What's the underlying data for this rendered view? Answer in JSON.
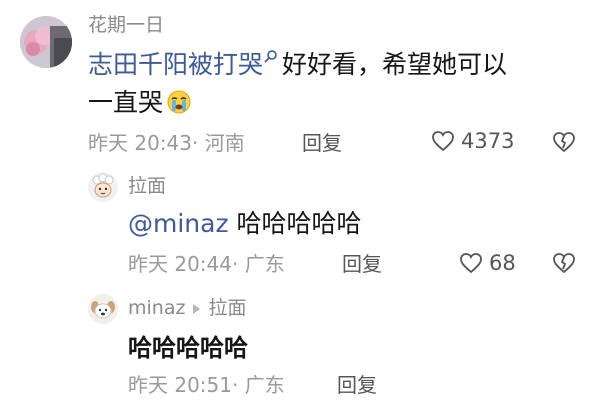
{
  "comments": [
    {
      "username": "花期一日",
      "link_text": "志田千阳被打哭",
      "text_line1": "好好看，希望她可以",
      "text_line2": "一直哭",
      "time": "昨天 20:43",
      "location": "· 河南",
      "reply_label": "回复",
      "likes": "4373"
    },
    {
      "username": "拉面",
      "mention": "@minaz",
      "text": "哈哈哈哈哈",
      "time": "昨天 20:44",
      "location": "· 广东",
      "reply_label": "回复",
      "likes": "68"
    },
    {
      "username": "minaz",
      "reply_to": "拉面",
      "text": "哈哈哈哈哈",
      "time": "昨天 20:51",
      "location": "· 广东",
      "reply_label": "回复"
    }
  ],
  "icons": [
    "avatar-flower-icon",
    "avatar-lamb-icon",
    "avatar-dog-icon",
    "search-icon",
    "crying-emoji-icon",
    "heart-outline-icon",
    "broken-heart-icon",
    "reply-arrow-icon"
  ],
  "colors": {
    "link": "#3d5a98",
    "meta": "#9a9a9a",
    "text": "#161616"
  }
}
